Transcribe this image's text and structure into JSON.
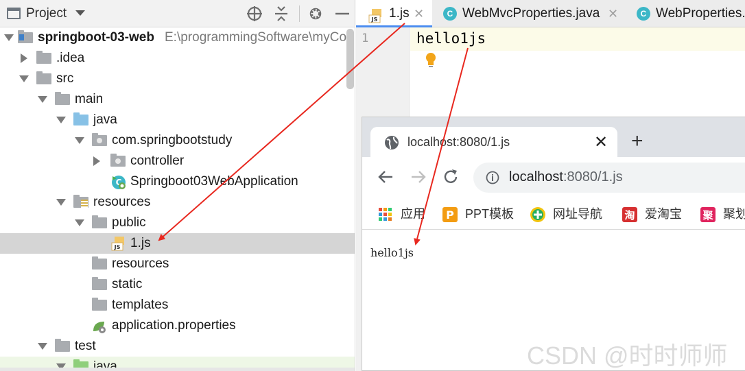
{
  "project_panel": {
    "title": "Project",
    "header_icons": [
      "locate-icon",
      "collapse-icon",
      "gear-icon",
      "minimize-icon"
    ],
    "tree": [
      {
        "label": "springboot-03-web",
        "path": "E:\\programmingSoftware\\myCo",
        "bold": true
      },
      {
        "label": ".idea"
      },
      {
        "label": "src"
      },
      {
        "label": "main"
      },
      {
        "label": "java"
      },
      {
        "label": "com.springbootstudy"
      },
      {
        "label": "controller"
      },
      {
        "label": "Springboot03WebApplication"
      },
      {
        "label": "resources"
      },
      {
        "label": "public"
      },
      {
        "label": "1.js",
        "selected": true
      },
      {
        "label": "resources"
      },
      {
        "label": "static"
      },
      {
        "label": "templates"
      },
      {
        "label": "application.properties"
      },
      {
        "label": "test"
      },
      {
        "label": "java"
      }
    ]
  },
  "editor": {
    "tabs": [
      {
        "label": "1.js",
        "active": true,
        "icon": "js-file-icon"
      },
      {
        "label": "WebMvcProperties.java",
        "active": false,
        "icon": "class-icon"
      },
      {
        "label": "WebProperties.",
        "active": false,
        "icon": "class-icon"
      }
    ],
    "line_number": "1",
    "code": "hello1js"
  },
  "browser": {
    "tab_title": "localhost:8080/1.js",
    "url_host": "localhost",
    "url_rest": ":8080/1.js",
    "bookmarks": [
      {
        "label": "应用",
        "icon": "apps-grid-icon"
      },
      {
        "label": "PPT模板",
        "icon": "ppt-icon"
      },
      {
        "label": "网址导航",
        "icon": "nav-plus-icon"
      },
      {
        "label": "爱淘宝",
        "icon": "taobao-icon"
      },
      {
        "label": "聚划",
        "icon": "juhuasuan-icon"
      }
    ],
    "page_text": "hello1js"
  },
  "watermark": "CSDN @时时师师",
  "colors": {
    "arrow": "#e8281f",
    "selection": "#d5d5d5",
    "tab_underline": "#4b8df0",
    "folder": "#a9acb0",
    "java_folder": "#87c1e6"
  }
}
